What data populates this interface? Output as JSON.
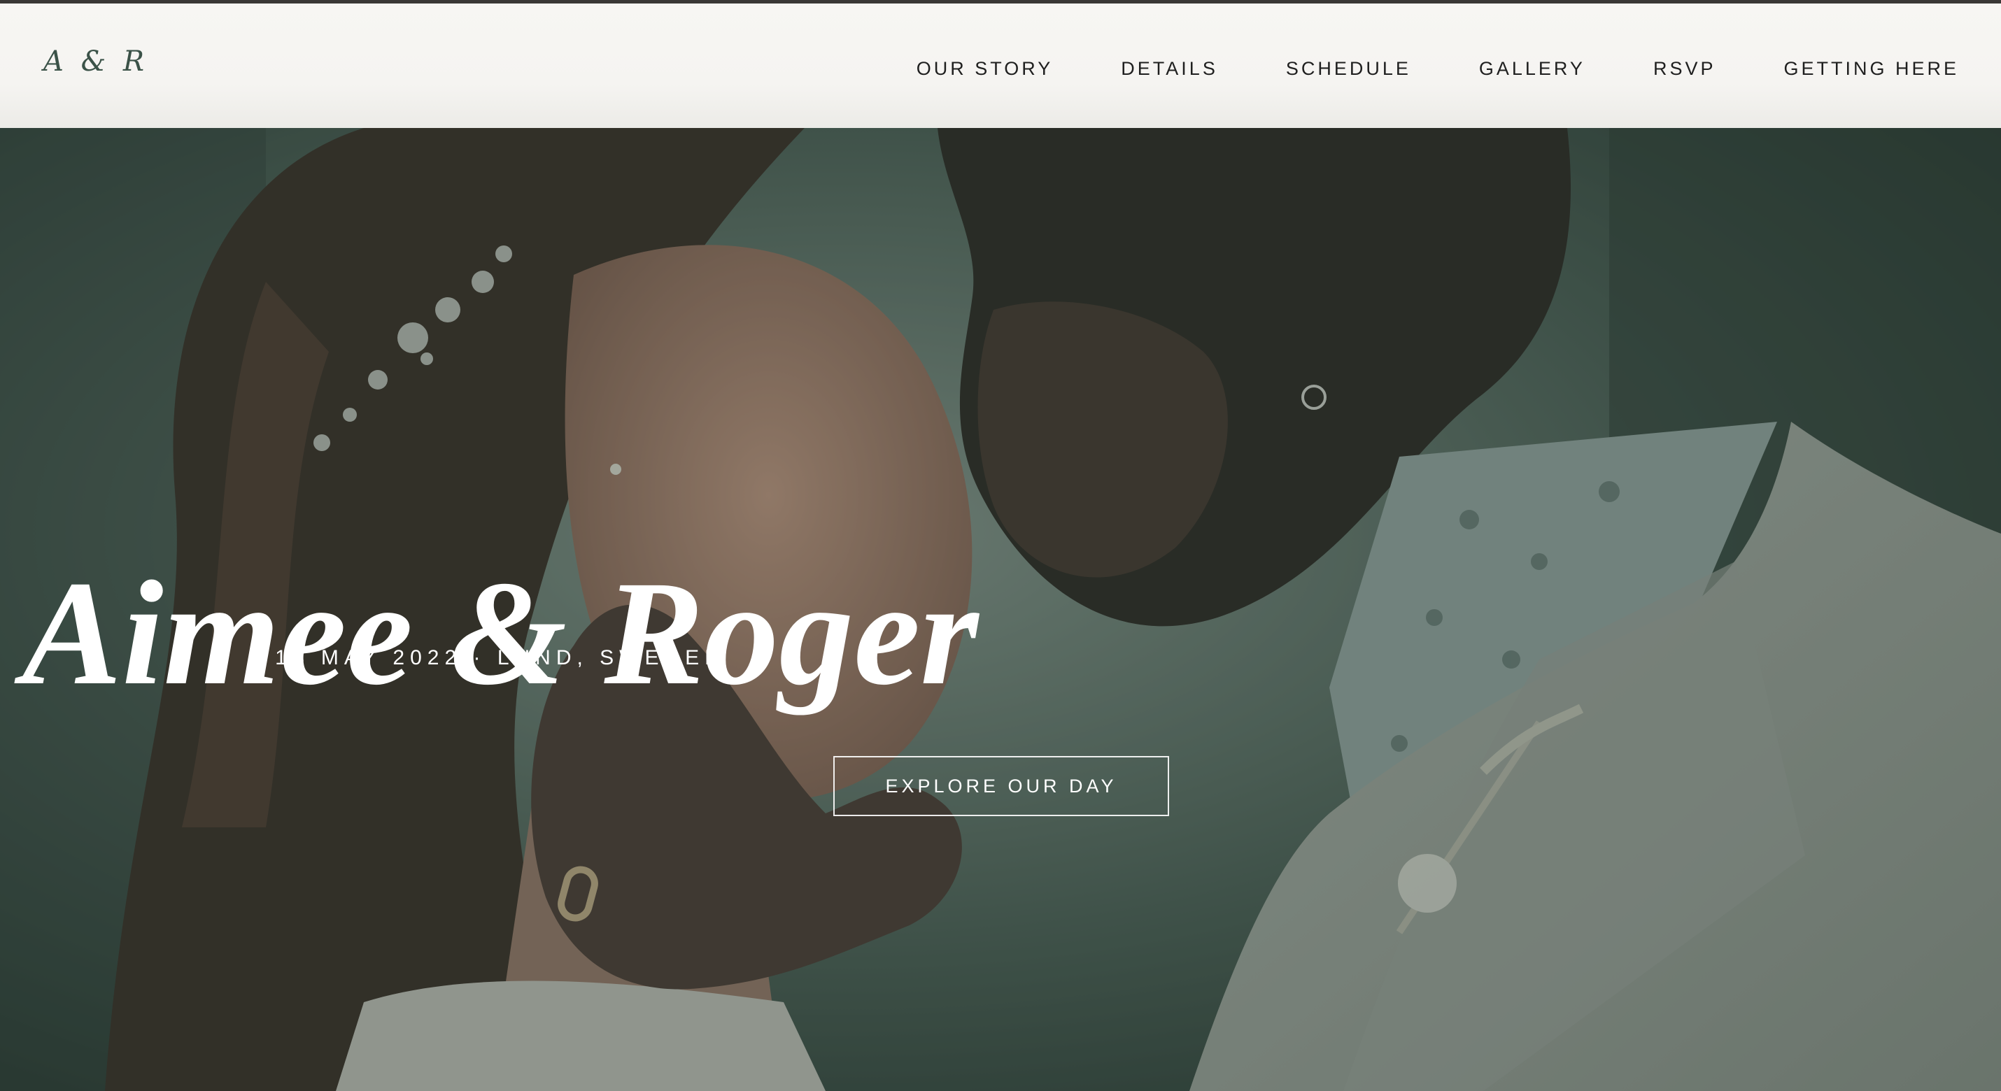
{
  "header": {
    "logo": "A & R",
    "nav": [
      {
        "label": "OUR STORY"
      },
      {
        "label": "DETAILS"
      },
      {
        "label": "SCHEDULE"
      },
      {
        "label": "GALLERY"
      },
      {
        "label": "RSVP"
      },
      {
        "label": "GETTING HERE"
      }
    ]
  },
  "hero": {
    "title": "Aimee & Roger",
    "subtitle": "14 MAY 2022 · LUND, SWEDEN",
    "cta_label": "EXPLORE OUR DAY"
  },
  "colors": {
    "nav_background": "#f5f4f1",
    "logo": "#3b5248",
    "overlay": "#263a32",
    "hero_text": "#ffffff"
  }
}
